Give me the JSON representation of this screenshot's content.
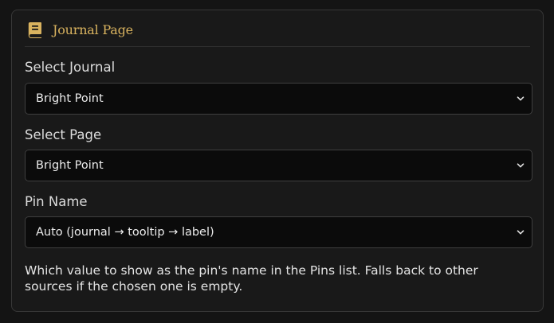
{
  "panel": {
    "title": "Journal Page",
    "icon": "book-icon",
    "accent": "#d9b35f"
  },
  "fields": [
    {
      "label": "Select Journal",
      "value": "Bright Point"
    },
    {
      "label": "Select Page",
      "value": "Bright Point"
    },
    {
      "label": "Pin Name",
      "value": "Auto (journal → tooltip → label)"
    }
  ],
  "help_text": "Which value to show as the pin's name in the Pins list. Falls back to other sources if the chosen one is empty."
}
